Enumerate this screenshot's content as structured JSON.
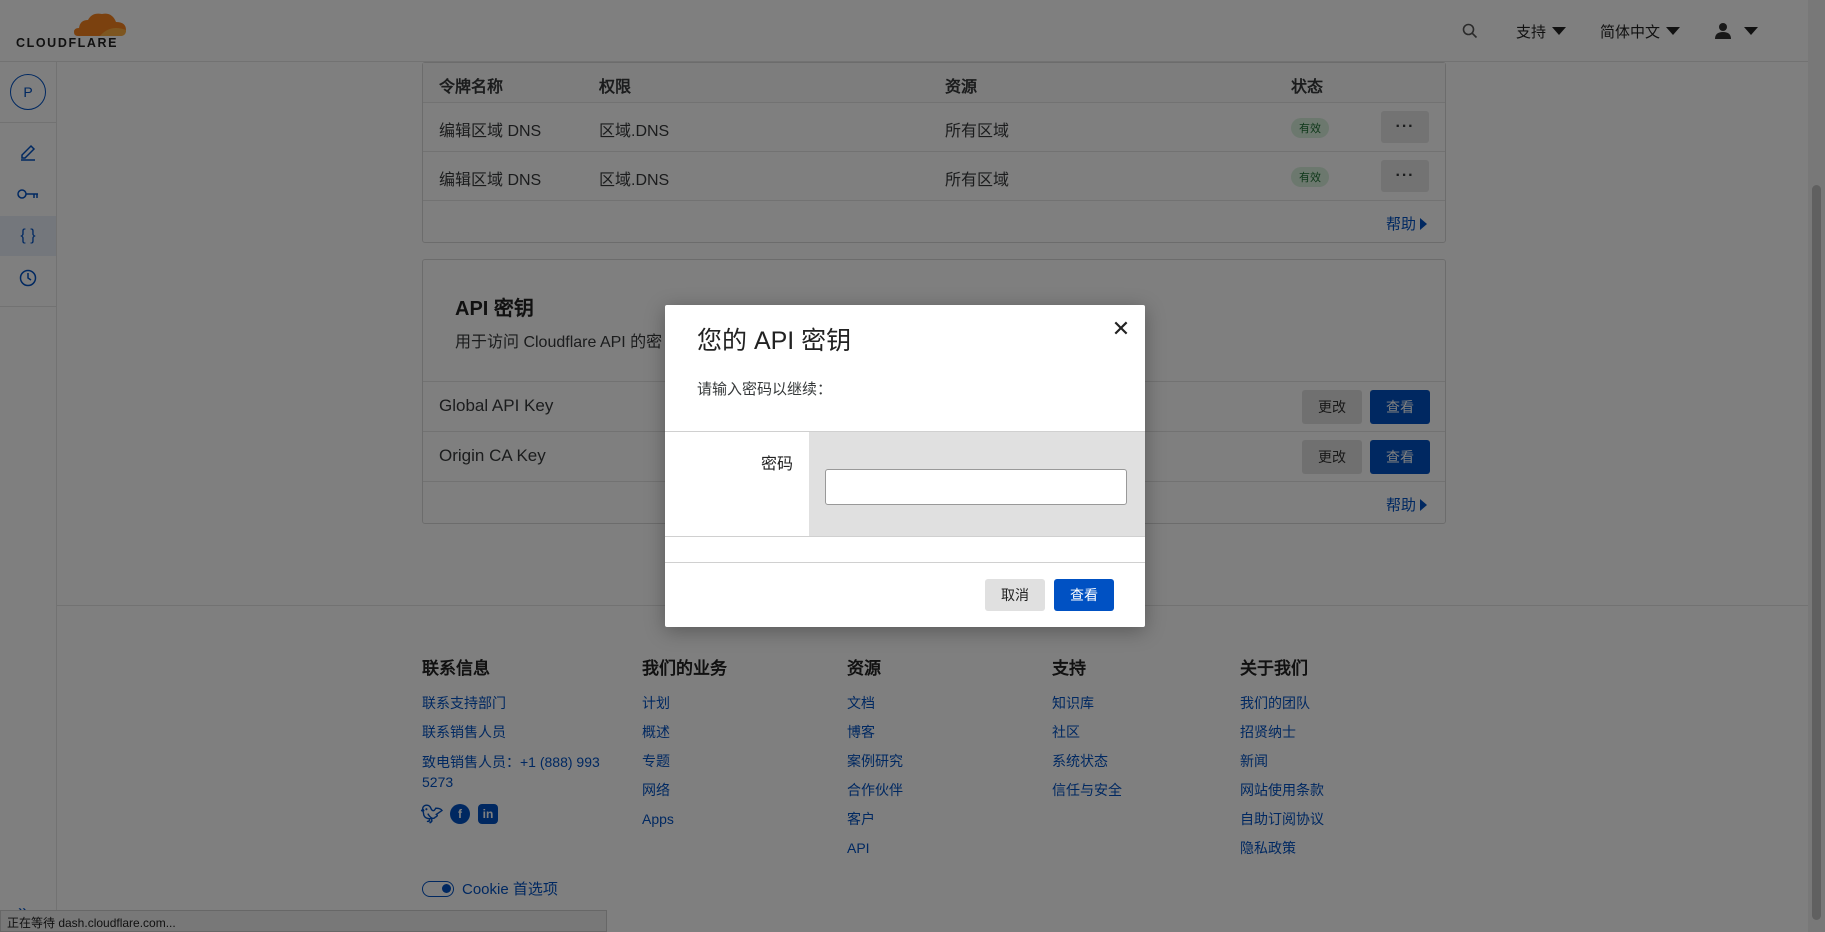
{
  "header": {
    "logo_text": "CLOUDFLARE",
    "support_label": "支持",
    "language_label": "简体中文"
  },
  "sidebar": {
    "avatar_letter": "P"
  },
  "tokens": {
    "columns": [
      "令牌名称",
      "权限",
      "资源",
      "状态"
    ],
    "rows": [
      {
        "name": "编辑区域 DNS",
        "permission": "区域.DNS",
        "resource": "所有区域",
        "status": "有效"
      },
      {
        "name": "编辑区域 DNS",
        "permission": "区域.DNS",
        "resource": "所有区域",
        "status": "有效"
      }
    ],
    "more_label": "···",
    "help_label": "帮助"
  },
  "api_keys": {
    "title": "API 密钥",
    "subtitle": "用于访问 Cloudflare API 的密",
    "rows": [
      {
        "name": "Global API Key",
        "change_label": "更改",
        "view_label": "查看"
      },
      {
        "name": "Origin CA Key",
        "change_label": "更改",
        "view_label": "查看"
      }
    ],
    "help_label": "帮助"
  },
  "footer": {
    "columns": [
      {
        "title": "联系信息",
        "links": [
          "联系支持部门",
          "联系销售人员",
          "致电销售人员：+1 (888) 993 5273"
        ]
      },
      {
        "title": "我们的业务",
        "links": [
          "计划",
          "概述",
          "专题",
          "网络",
          "Apps"
        ]
      },
      {
        "title": "资源",
        "links": [
          "文档",
          "博客",
          "案例研究",
          "合作伙伴",
          "客户",
          "API"
        ]
      },
      {
        "title": "支持",
        "links": [
          "知识库",
          "社区",
          "系统状态",
          "信任与安全"
        ]
      },
      {
        "title": "关于我们",
        "links": [
          "我们的团队",
          "招贤纳士",
          "新闻",
          "网站使用条款",
          "自助订阅协议",
          "隐私政策"
        ]
      }
    ],
    "cookie_label": "Cookie 首选项"
  },
  "status_bar": {
    "text": "正在等待 dash.cloudflare.com..."
  },
  "modal": {
    "title": "您的 API 密钥",
    "description": "请输入密码以继续：",
    "password_label": "密码",
    "password_value": "",
    "cancel_label": "取消",
    "view_label": "查看"
  }
}
